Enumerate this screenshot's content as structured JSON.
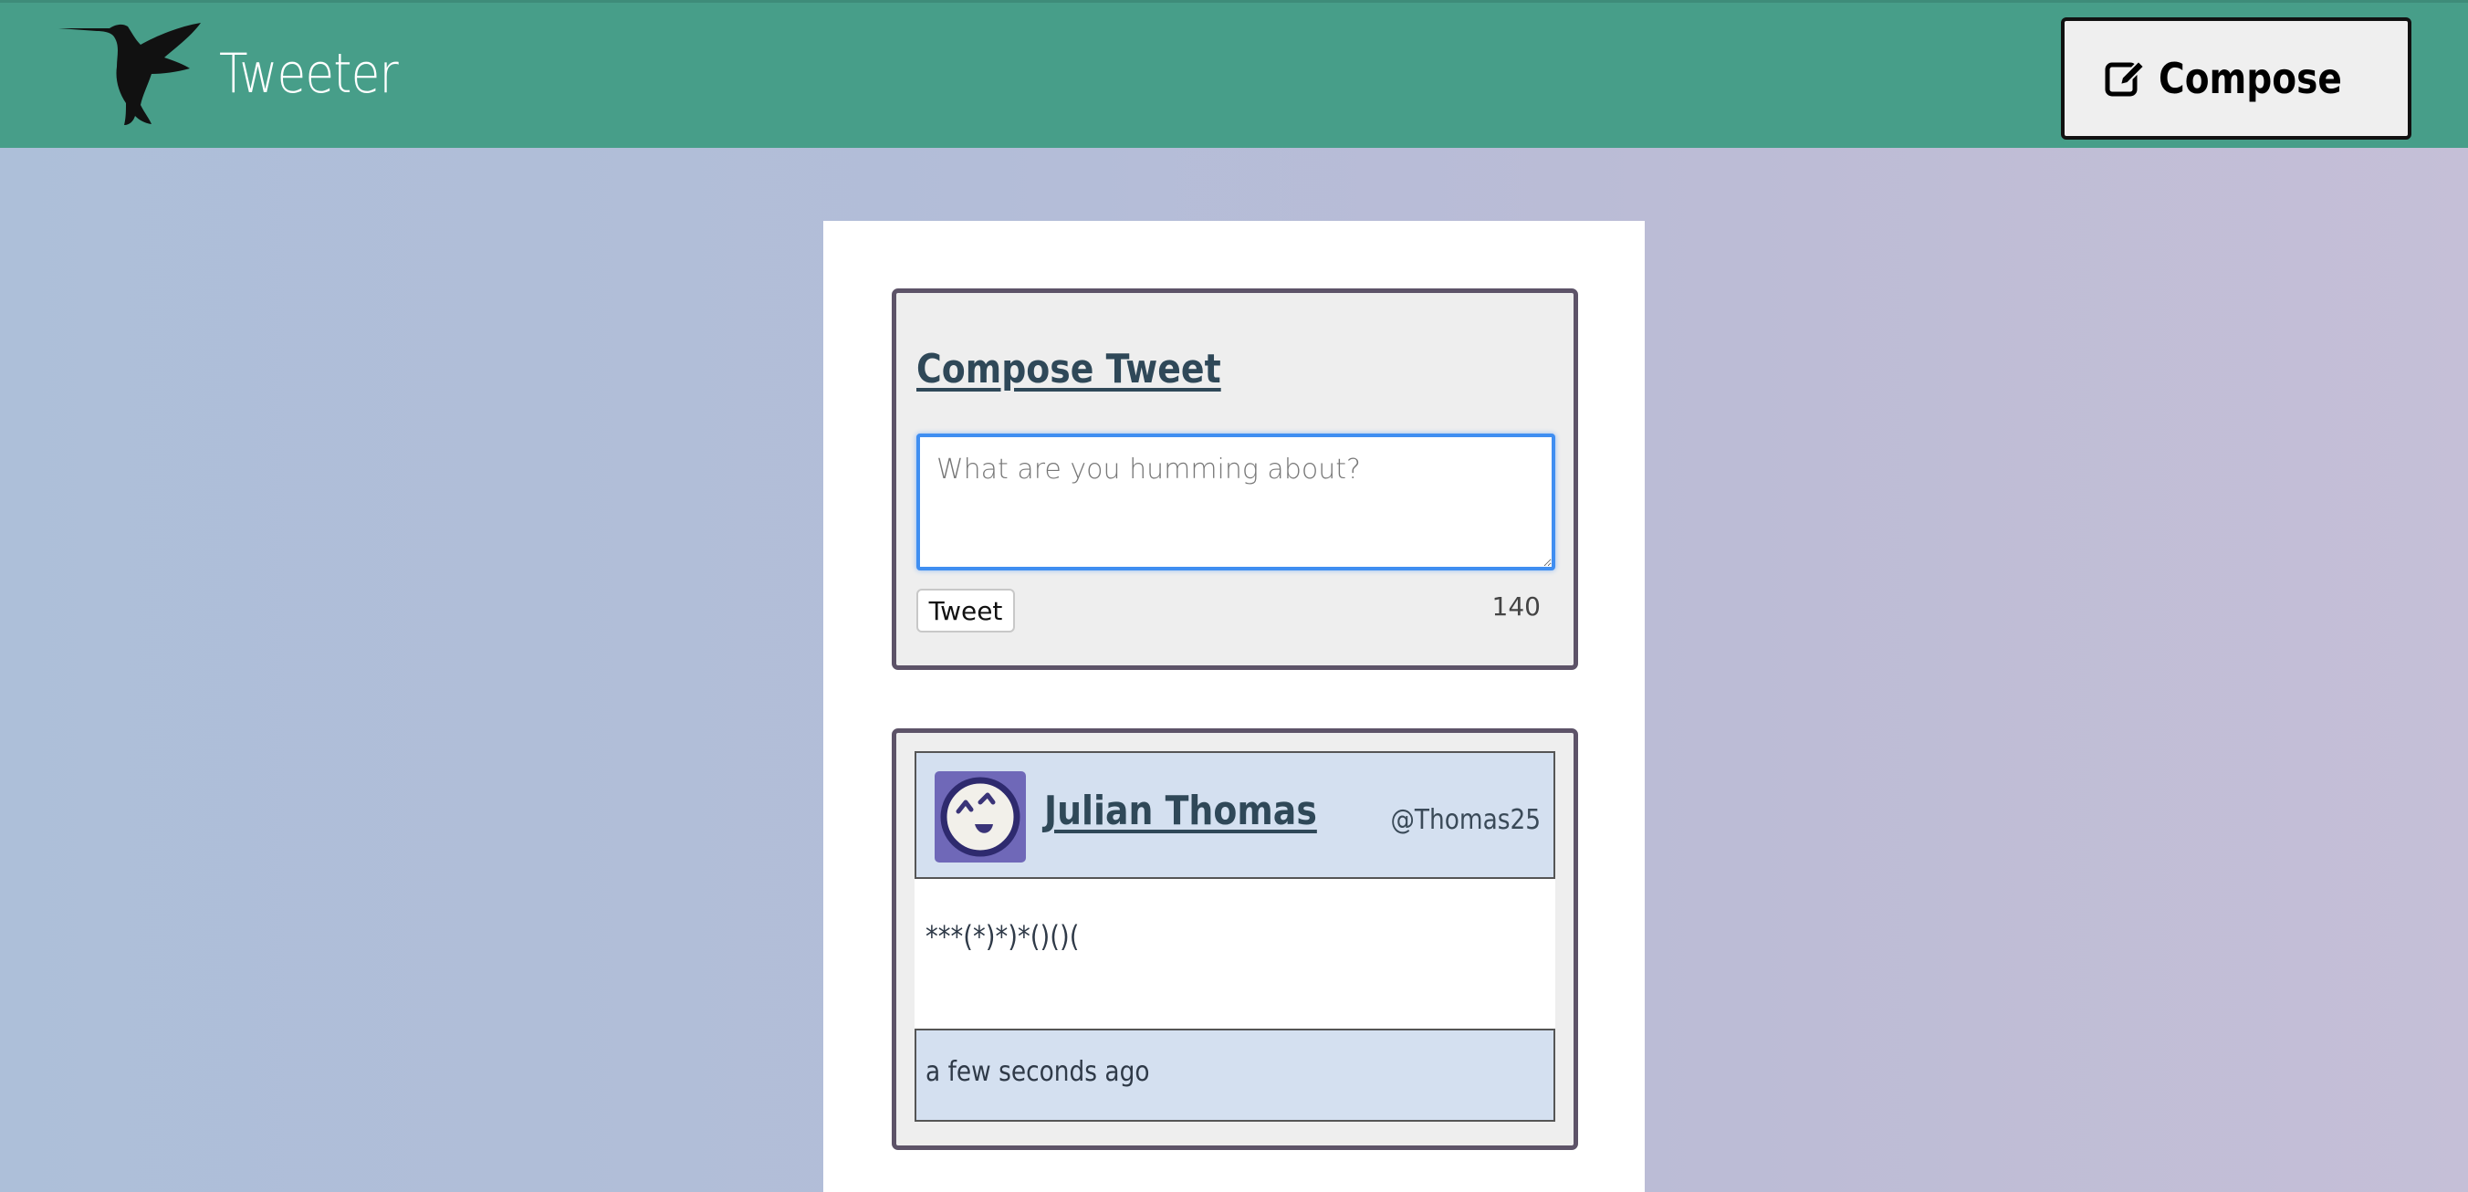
{
  "header": {
    "app_title": "Tweeter",
    "logo_icon": "hummingbird-icon",
    "compose_button": {
      "label": "Compose",
      "icon": "edit-icon"
    }
  },
  "compose": {
    "heading": "Compose Tweet",
    "textarea": {
      "value": "",
      "placeholder": "What are you humming about?"
    },
    "submit_label": "Tweet",
    "char_counter": "140"
  },
  "tweets": [
    {
      "author_name": "Julian Thomas",
      "handle": "@Thomas25",
      "avatar_icon": "smiley-avatar-icon",
      "text": "***(*)*)*()()(",
      "timestamp": "a few seconds ago"
    }
  ],
  "colors": {
    "header_bg": "#479e89",
    "panel_border": "#5d5368",
    "heading_text": "#2f4858",
    "tweet_header_bg": "#d4e0f0",
    "avatar_bg": "#6f68b8"
  }
}
